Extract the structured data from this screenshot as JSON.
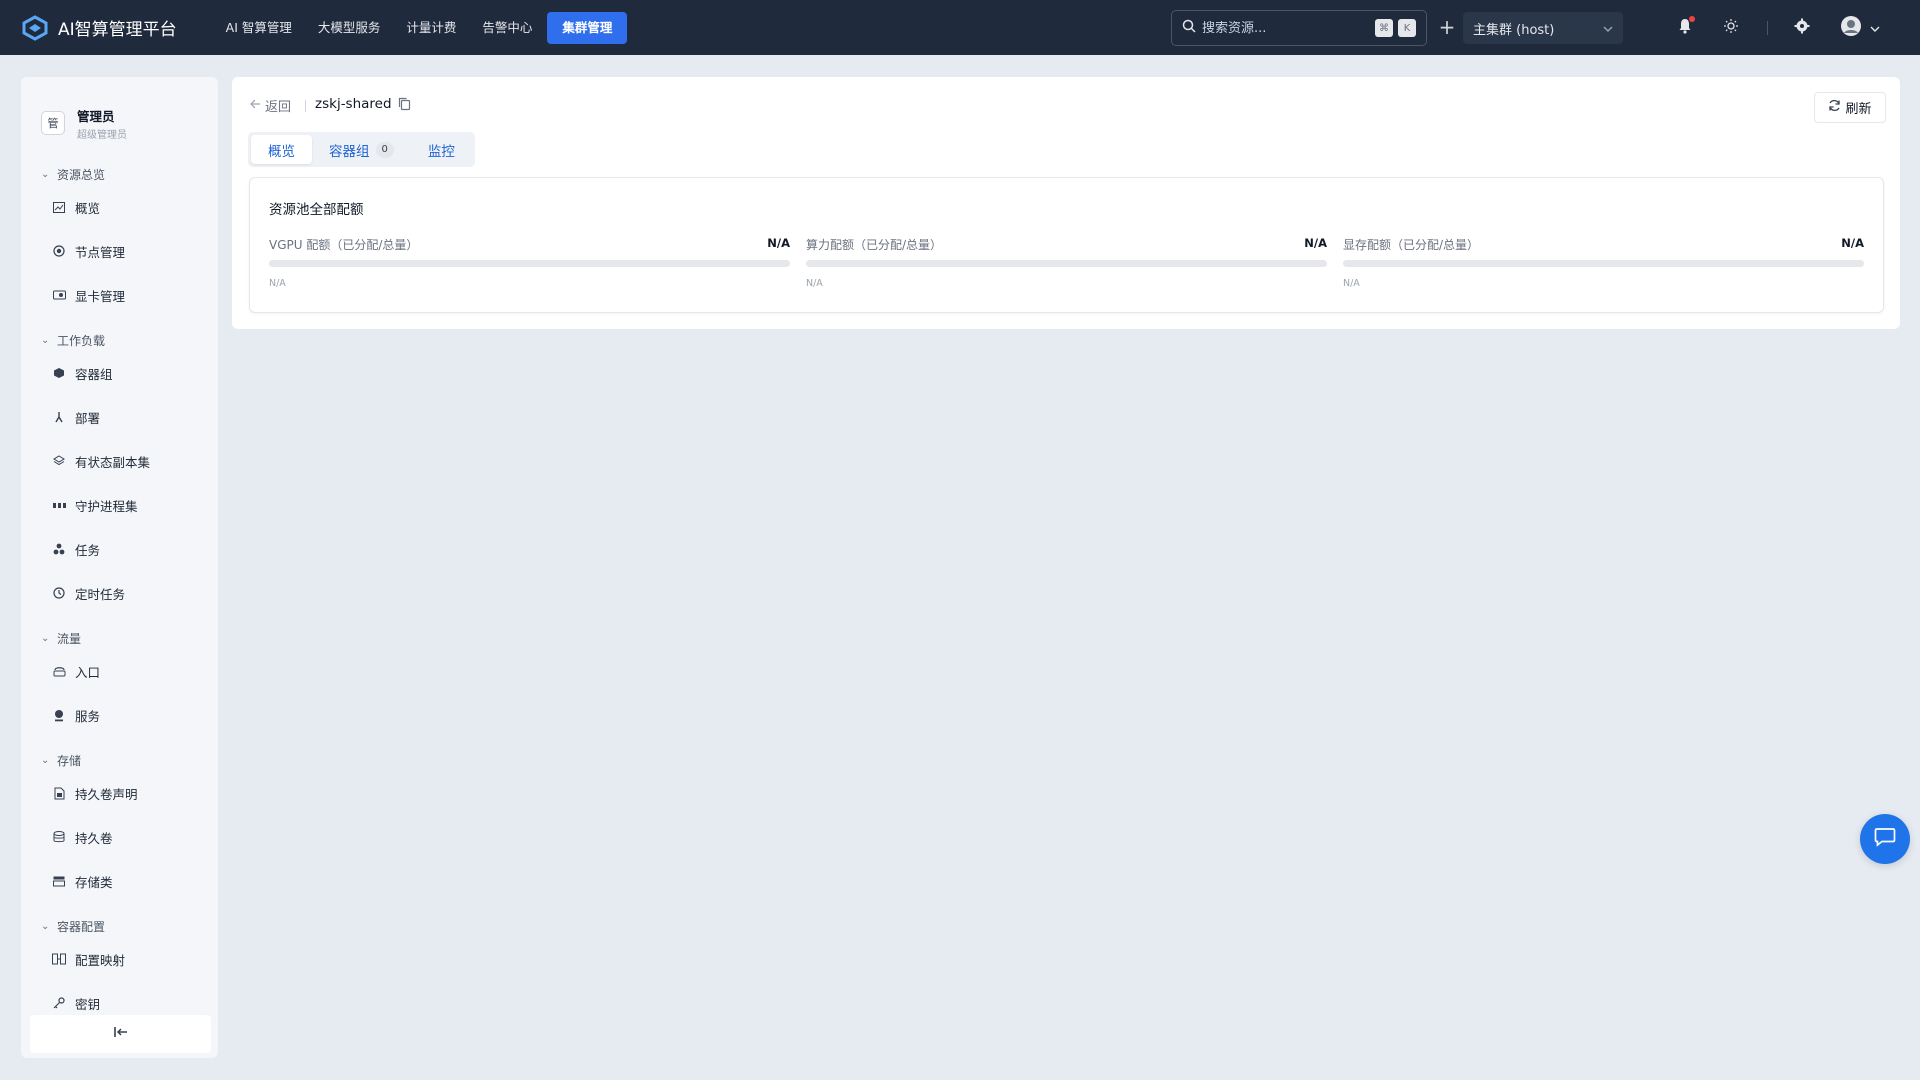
{
  "brand": {
    "title": "AI智算管理平台",
    "logo_icon": "hexagon-logo-icon"
  },
  "nav": {
    "items": [
      {
        "label": "AI 智算管理",
        "active": false
      },
      {
        "label": "大模型服务",
        "active": false
      },
      {
        "label": "计量计费",
        "active": false
      },
      {
        "label": "告警中心",
        "active": false
      },
      {
        "label": "集群管理",
        "active": true
      }
    ]
  },
  "search": {
    "placeholder": "搜索资源...",
    "kbd1": "⌘",
    "kbd2": "K"
  },
  "cluster": {
    "selected": "主集群 (host)"
  },
  "colors": {
    "topbar": "#1f2a3c",
    "accent": "#2f6fed",
    "tab_text": "#1e63d6",
    "fab": "#1e74e8"
  },
  "user": {
    "name": "管理员",
    "role": "超级管理员",
    "avatar": "管"
  },
  "sidebar": {
    "groups": [
      {
        "title": "资源总览",
        "items": [
          {
            "label": "概览",
            "icon": "chart-icon"
          },
          {
            "label": "节点管理",
            "icon": "node-icon"
          },
          {
            "label": "显卡管理",
            "icon": "gpu-card-icon"
          }
        ]
      },
      {
        "title": "工作负载",
        "items": [
          {
            "label": "容器组",
            "icon": "cube-icon"
          },
          {
            "label": "部署",
            "icon": "deploy-icon"
          },
          {
            "label": "有状态副本集",
            "icon": "layers-icon"
          },
          {
            "label": "守护进程集",
            "icon": "daemon-icon"
          },
          {
            "label": "任务",
            "icon": "job-icon"
          },
          {
            "label": "定时任务",
            "icon": "clock-icon"
          }
        ]
      },
      {
        "title": "流量",
        "items": [
          {
            "label": "入口",
            "icon": "ingress-icon"
          },
          {
            "label": "服务",
            "icon": "service-icon"
          }
        ]
      },
      {
        "title": "存储",
        "items": [
          {
            "label": "持久卷声明",
            "icon": "pvc-icon"
          },
          {
            "label": "持久卷",
            "icon": "database-icon"
          },
          {
            "label": "存储类",
            "icon": "storage-class-icon"
          }
        ]
      },
      {
        "title": "容器配置",
        "items": [
          {
            "label": "配置映射",
            "icon": "configmap-icon"
          },
          {
            "label": "密钥",
            "icon": "key-icon"
          }
        ]
      }
    ],
    "collapse_icon": "collapse-left-icon"
  },
  "page": {
    "back_label": "返回",
    "resource_name": "zskj-shared",
    "refresh_label": "刷新",
    "tabs": [
      {
        "label": "概览",
        "active": true
      },
      {
        "label": "容器组",
        "count": "0",
        "active": false
      },
      {
        "label": "监控",
        "active": false
      }
    ],
    "quota": {
      "title": "资源池全部配额",
      "items": [
        {
          "label": "VGPU 配额（已分配/总量）",
          "value": "N/A",
          "sub": "N/A",
          "fill": 0
        },
        {
          "label": "算力配额（已分配/总量）",
          "value": "N/A",
          "sub": "N/A",
          "fill": 0
        },
        {
          "label": "显存配额（已分配/总量）",
          "value": "N/A",
          "sub": "N/A",
          "fill": 0
        }
      ]
    }
  }
}
